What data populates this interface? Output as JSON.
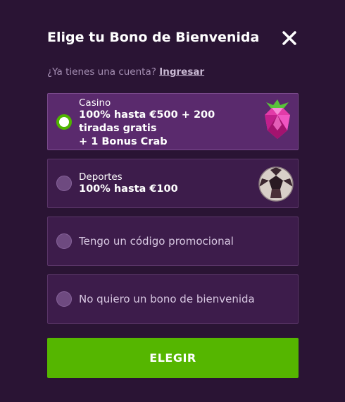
{
  "modal": {
    "title": "Elige tu Bono de Bienvenida",
    "login_prompt": "¿Ya tienes una cuenta?",
    "login_link": "Ingresar"
  },
  "options": [
    {
      "category": "Casino",
      "text": "100% hasta €500 + 200\ntiradas gratis\n+ 1 Bonus Crab",
      "selected": true,
      "icon": "raspberry-gem-icon"
    },
    {
      "category": "Deportes",
      "text": "100% hasta €100",
      "selected": false,
      "icon": "soccer-ball-icon"
    },
    {
      "text": "Tengo un código promocional",
      "selected": false
    },
    {
      "text": "No quiero un bono de bienvenida",
      "selected": false
    }
  ],
  "cta_label": "ELEGIR",
  "colors": {
    "background": "#2a1434",
    "card": "#3d1c4b",
    "card_selected": "#5a2a6d",
    "accent_green": "#55b600"
  }
}
